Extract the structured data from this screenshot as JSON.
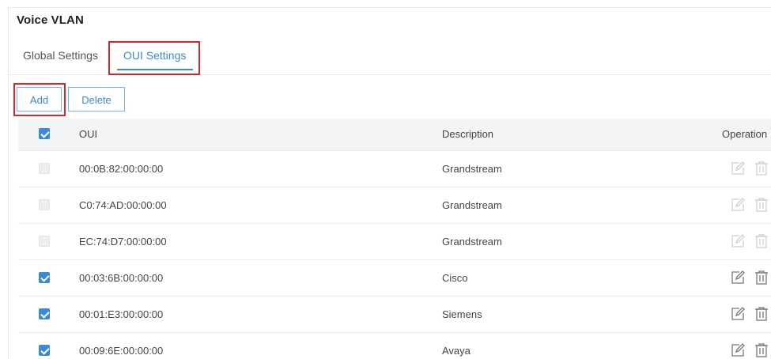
{
  "page": {
    "title": "Voice VLAN"
  },
  "tabs": [
    {
      "label": "Global Settings",
      "active": false
    },
    {
      "label": "OUI Settings",
      "active": true
    }
  ],
  "toolbar": {
    "add_label": "Add",
    "delete_label": "Delete"
  },
  "table": {
    "headers": {
      "oui": "OUI",
      "description": "Description",
      "operation": "Operation"
    },
    "rows": [
      {
        "oui": "00:0B:82:00:00:00",
        "description": "Grandstream",
        "checked": false,
        "disabled": true
      },
      {
        "oui": "C0:74:AD:00:00:00",
        "description": "Grandstream",
        "checked": false,
        "disabled": true
      },
      {
        "oui": "EC:74:D7:00:00:00",
        "description": "Grandstream",
        "checked": false,
        "disabled": true
      },
      {
        "oui": "00:03:6B:00:00:00",
        "description": "Cisco",
        "checked": true,
        "disabled": false
      },
      {
        "oui": "00:01:E3:00:00:00",
        "description": "Siemens",
        "checked": true,
        "disabled": false
      },
      {
        "oui": "00:09:6E:00:00:00",
        "description": "Avaya",
        "checked": true,
        "disabled": false
      }
    ]
  },
  "icons": {
    "edit": "edit-icon",
    "delete": "trash-icon"
  },
  "colors": {
    "accent": "#3a8ad7",
    "highlight": "#d6262d",
    "disabled_icon": "#cfcfcf",
    "active_icon": "#777777"
  }
}
